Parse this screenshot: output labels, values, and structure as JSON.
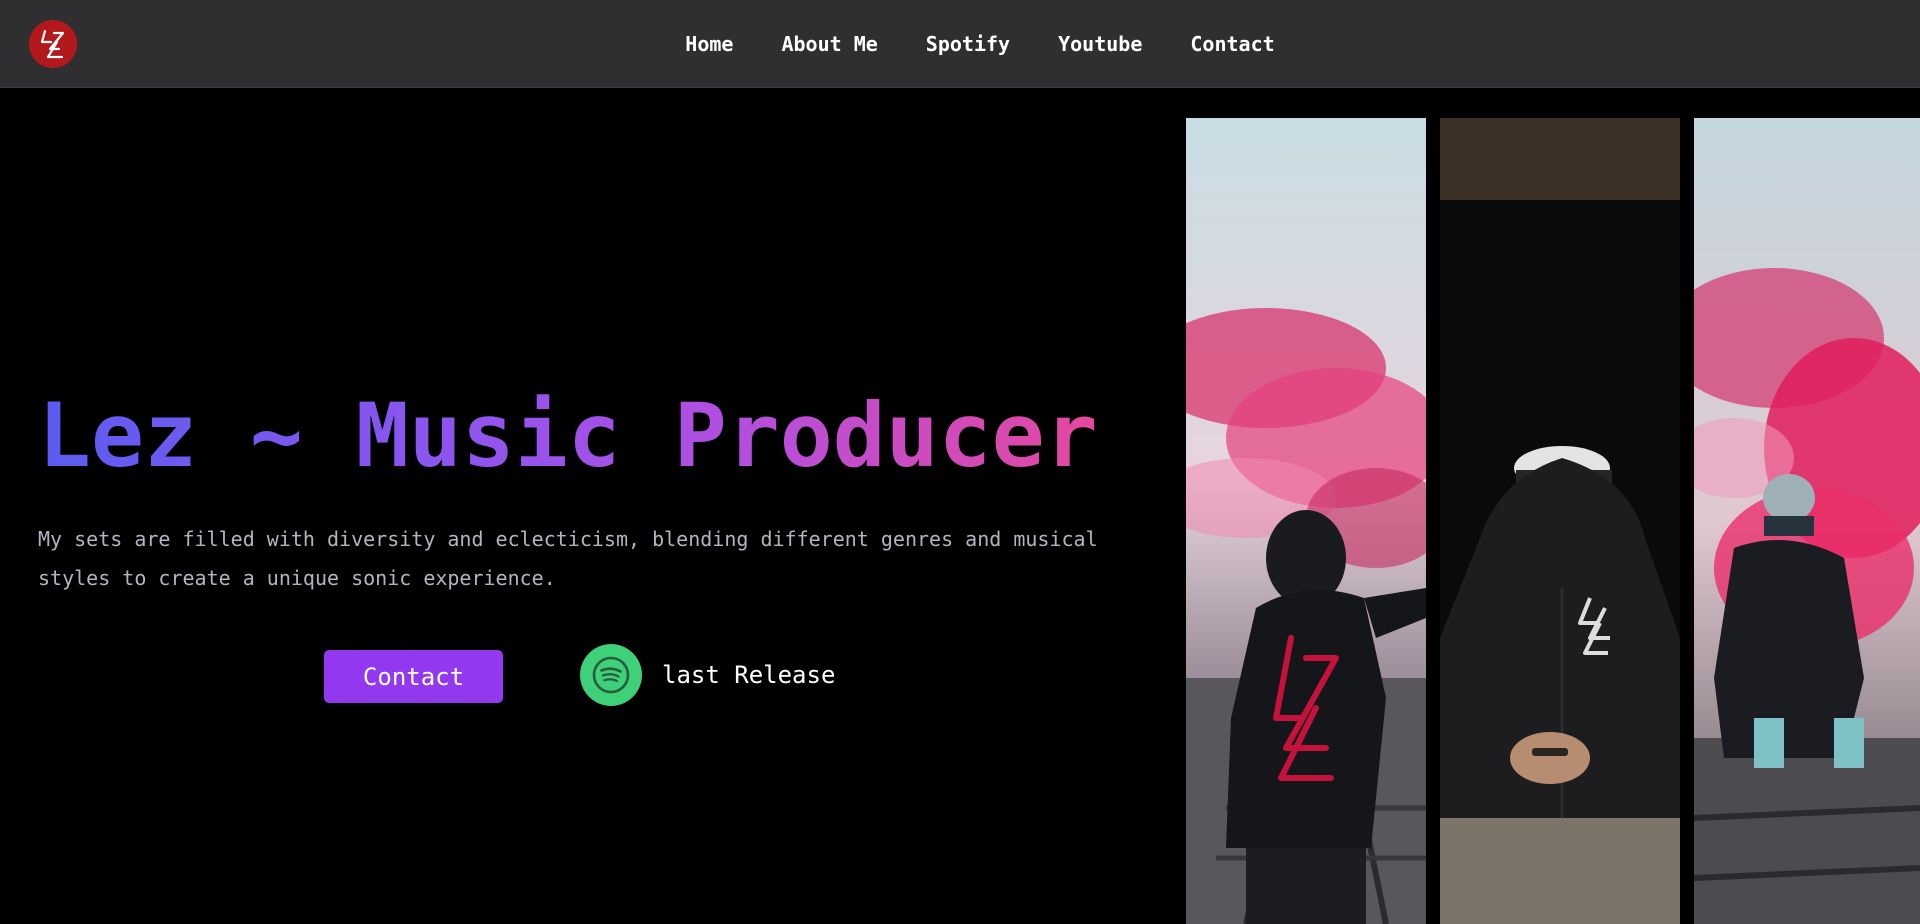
{
  "nav": {
    "logo_icon": "lez-logo-icon",
    "links": [
      {
        "label": "Home"
      },
      {
        "label": "About Me"
      },
      {
        "label": "Spotify"
      },
      {
        "label": "Youtube"
      },
      {
        "label": "Contact"
      }
    ]
  },
  "hero": {
    "title": "Lez ~ Music Producer",
    "description": "My sets are filled with diversity and eclecticism, blending different genres and musical styles to create a unique sonic experience.",
    "contact_label": "Contact",
    "release_label": "last Release",
    "release_icon": "spotify-icon"
  },
  "gallery": {
    "photos": [
      {
        "subject": "hooded figure with pink smoke on railway"
      },
      {
        "subject": "masked figure in black hoodie"
      },
      {
        "subject": "crouching figure with pink smoke on railway"
      }
    ]
  },
  "colors": {
    "navbar_bg": "#2f2f31",
    "logo_bg": "#b3191c",
    "contact_button": "#9238ee",
    "spotify_green": "#3fd07a",
    "gradient_start": "#5c5cf0",
    "gradient_end": "#e5489f"
  }
}
